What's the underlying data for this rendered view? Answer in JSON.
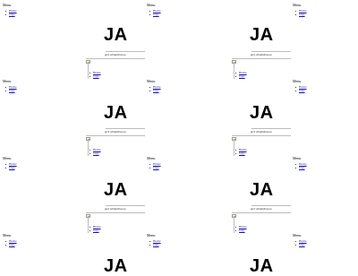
{
  "menu": {
    "title": "Menu",
    "items": [
      "Home",
      "Gigs"
    ]
  },
  "hero": {
    "logo": "JA",
    "tagline": "jazz whatisthat.eu"
  },
  "content": {
    "items": [
      "Home",
      "Gigs"
    ]
  },
  "colors": {
    "link": "#1a0dab",
    "divider": "#bbbbbb"
  }
}
